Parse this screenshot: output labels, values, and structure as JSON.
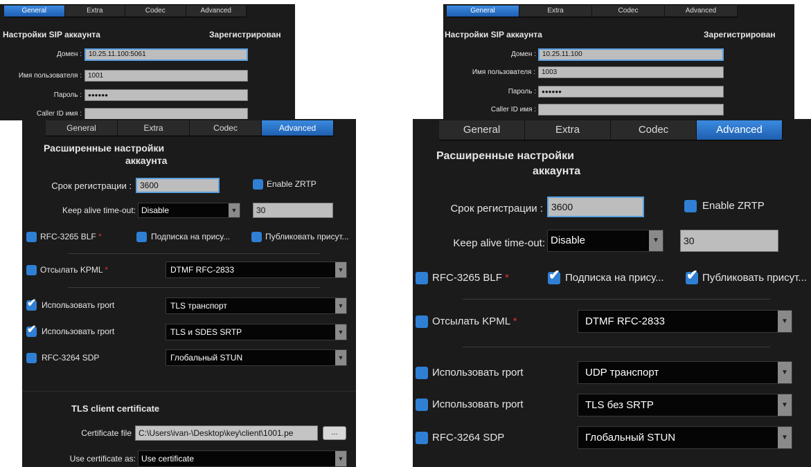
{
  "tabs": [
    "General",
    "Extra",
    "Codec",
    "Advanced"
  ],
  "sip": {
    "title": "Настройки SIP аккаунта",
    "status": "Зарегистрирован",
    "domain_label": "Домен :",
    "user_label": "Имя пользователя :",
    "password_label": "Пароль :",
    "callerid_label": "Caller ID имя :",
    "password_mask": "●●●●●●"
  },
  "left": {
    "domain": "10.25.11.100:5061",
    "user": "1001",
    "advanced_title_line1": "Расширенные настройки",
    "advanced_title_line2": "аккаунта",
    "reg_label": "Срок регистрации :",
    "reg_value": "3600",
    "zrtp": "Enable ZRTP",
    "keepalive_label": "Keep alive time-out:",
    "keepalive_value": "Disable",
    "keepalive_seconds": "30",
    "blf": "RFC-3265 BLF",
    "subscribe": "Подписка на прису...",
    "publish": "Публиковать присут...",
    "kpml": "Отсылать KPML",
    "kpml_value": "DTMF RFC-2833",
    "rport1": "Использовать rport",
    "rport1_value": "TLS транспорт",
    "rport2": "Использовать rport",
    "rport2_value": "TLS и SDES SRTP",
    "sdp": "RFC-3264 SDP",
    "sdp_value": "Глобальный STUN",
    "tls_title": "TLS client certificate",
    "cert_label": "Certificate file",
    "cert_value": "C:\\Users\\ivan-\\Desktop\\key\\client\\1001.pe",
    "cert_button": "...",
    "use_cert_label": "Use certificate as:",
    "use_cert_value": "Use certificate",
    "star": "*"
  },
  "right": {
    "domain": "10.25.11.100",
    "user": "1003",
    "advanced_title_line1": "Расширенные настройки",
    "advanced_title_line2": "аккаунта",
    "reg_label": "Срок регистрации :",
    "reg_value": "3600",
    "zrtp": "Enable ZRTP",
    "keepalive_label": "Keep alive time-out:",
    "keepalive_value": "Disable",
    "keepalive_seconds": "30",
    "blf": "RFC-3265 BLF",
    "subscribe": "Подписка на прису...",
    "publish": "Публиковать присут...",
    "kpml": "Отсылать KPML",
    "kpml_value": "DTMF RFC-2833",
    "rport1": "Использовать rport",
    "rport1_value": "UDP транспорт",
    "rport2": "Использовать rport",
    "rport2_value": "TLS без SRTP",
    "sdp": "RFC-3264 SDP",
    "sdp_value": "Глобальный STUN",
    "star": "*"
  }
}
